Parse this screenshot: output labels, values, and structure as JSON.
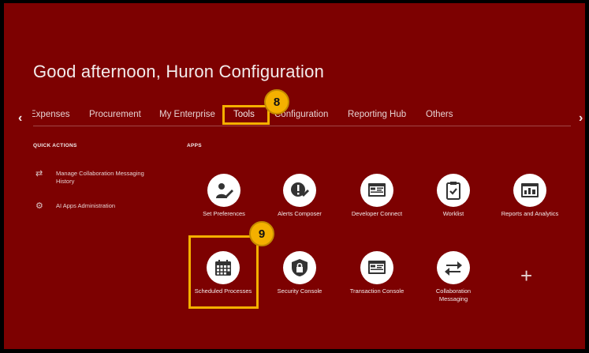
{
  "greeting": "Good afternoon, Huron Configuration",
  "tabs": [
    {
      "label": "Expenses"
    },
    {
      "label": "Procurement"
    },
    {
      "label": "My Enterprise"
    },
    {
      "label": "Tools"
    },
    {
      "label": "Configuration"
    },
    {
      "label": "Reporting Hub"
    },
    {
      "label": "Others"
    }
  ],
  "active_tab": "Tools",
  "callouts": {
    "step1": "8",
    "step2": "9"
  },
  "quick_actions": {
    "title": "QUICK ACTIONS",
    "items": [
      {
        "label": "Manage Collaboration Messaging History",
        "icon": "arrows-swap-icon"
      },
      {
        "label": "AI Apps Administration",
        "icon": "gears-icon"
      }
    ]
  },
  "apps": {
    "title": "APPS",
    "items": [
      {
        "label": "Set Preferences",
        "icon": "person-edit-icon"
      },
      {
        "label": "Alerts Composer",
        "icon": "alert-wrench-icon"
      },
      {
        "label": "Developer Connect",
        "icon": "developer-screen-icon"
      },
      {
        "label": "Worklist",
        "icon": "clipboard-check-icon"
      },
      {
        "label": "Reports and Analytics",
        "icon": "report-chart-icon"
      },
      {
        "label": "Scheduled Processes",
        "icon": "calendar-icon"
      },
      {
        "label": "Security Console",
        "icon": "shield-lock-icon"
      },
      {
        "label": "Transaction Console",
        "icon": "transaction-screen-icon"
      },
      {
        "label": "Collaboration Messaging",
        "icon": "arrows-swap-icon"
      }
    ]
  },
  "colors": {
    "background": "#7d0101",
    "highlight": "#f4b000",
    "text": "#f3ecec"
  }
}
